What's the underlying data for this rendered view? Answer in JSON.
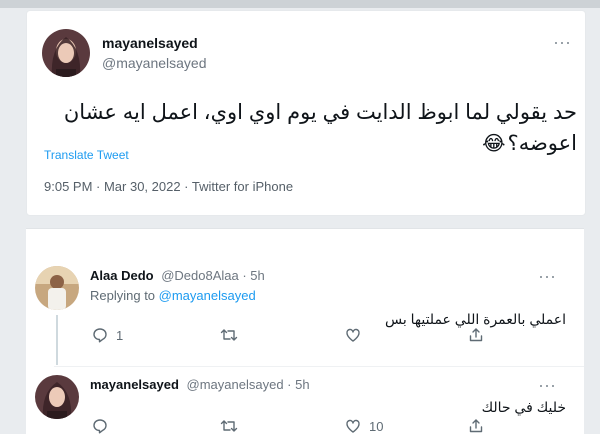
{
  "main_tweet": {
    "display_name": "mayanelsayed",
    "handle": "@mayanelsayed",
    "text_line1": "حد يقولي لما ابوظ الدايت في يوم اوي اوي، اعمل ايه عشان",
    "text_line2": "اعوضه؟",
    "emoji": "😂",
    "translate_label": "Translate Tweet",
    "timestamp": "9:05 PM · Mar 30, 2022 · Twitter for iPhone",
    "more_icon": "more-dots-icon"
  },
  "reply1": {
    "display_name": "Alaa Dedo",
    "handle_time": "@Dedo8Alaa · 5h",
    "replying_prefix": "Replying to ",
    "replying_to": "@mayanelsayed",
    "text": "اعملي بالعمرة اللي عملتيها بس",
    "reply_count": "1"
  },
  "reply2": {
    "display_name": "mayanelsayed",
    "handle_time": "@mayanelsayed · 5h",
    "text": "خليك في حالك",
    "retweet_count": "",
    "like_count": "10"
  },
  "colors": {
    "link": "#1d9bf0",
    "secondary_text": "#6d7680",
    "background": "#e9ecef"
  }
}
